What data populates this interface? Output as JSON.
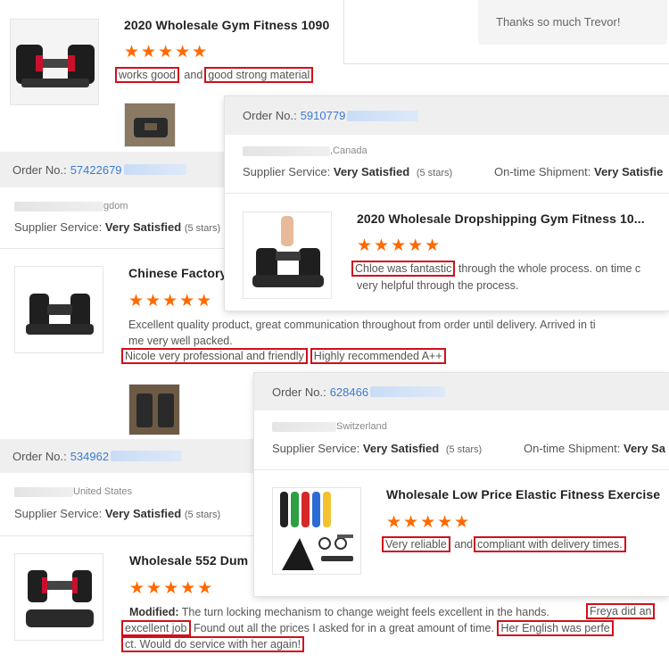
{
  "top_card": {
    "product_title": "2020 Wholesale Gym Fitness 1090",
    "stars": "★★★★★",
    "review": {
      "hl1": "works good",
      "mid": "and",
      "hl2": "good strong material"
    }
  },
  "reply_box": {
    "text": "Thanks so much Trevor!"
  },
  "card_2": {
    "order_label": "Order No.:",
    "order_number": "57422679",
    "country_suffix": "gdom",
    "supplier_label": "Supplier Service:",
    "supplier_value": "Very Satisfied",
    "supplier_stars": "(5 stars)",
    "product_title": "Chinese Factory",
    "stars": "★★★★★",
    "review_line1": "Excellent quality product, great communication throughout from order until delivery. Arrived in ti",
    "review_line2": "me  very well packed.",
    "hl1": "Nicole very professional and friendly",
    "hl2": "Highly recommended A++"
  },
  "card_3": {
    "order_label": "Order No.:",
    "order_number": "534962",
    "country": "United States",
    "supplier_label": "Supplier Service:",
    "supplier_value": "Very Satisfied",
    "supplier_stars": "(5 stars)",
    "product_title": "Wholesale 552 Dum",
    "stars": "★★★★★",
    "review_label": "Modified:",
    "review_text": "The turn locking mechanism to change weight feels excellent in the hands.",
    "hl1a": "Freya did an",
    "hl1b": "excellent job",
    "review_mid": "Found out all the prices I asked for in a great amount of time.",
    "hl2a": "Her English was perfe",
    "hl2b": "ct. Would do service with her again!"
  },
  "canada_card": {
    "order_label": "Order No.:",
    "order_number": "5910779",
    "country": ",Canada",
    "supplier_label": "Supplier Service:",
    "supplier_value": "Very Satisfied",
    "supplier_stars": "(5 stars)",
    "shipment_label": "On-time Shipment:",
    "shipment_value": "Very Satisfie",
    "product_title": "2020 Wholesale Dropshipping Gym Fitness 10...",
    "stars": "★★★★★",
    "hl1": "Chloe was fantastic",
    "review_rest": "through the whole process. on time c",
    "review_line2": "very helpful through the process."
  },
  "swiss_card": {
    "order_label": "Order No.:",
    "order_number": "628466",
    "country": "Switzerland",
    "supplier_label": "Supplier Service:",
    "supplier_value": "Very Satisfied",
    "supplier_stars": "(5 stars)",
    "shipment_label": "On-time Shipment:",
    "shipment_value": "Very Sa",
    "product_title": "Wholesale Low Price Elastic Fitness Exercise",
    "stars": "★★★★★",
    "hl1": "Very reliable",
    "mid": "and",
    "hl2": "compliant with delivery times."
  },
  "colors": {
    "star": "#ff6a00",
    "highlight_border": "#d0101b",
    "order_link": "#3a7bd5",
    "order_bar_bg": "#efefef"
  }
}
